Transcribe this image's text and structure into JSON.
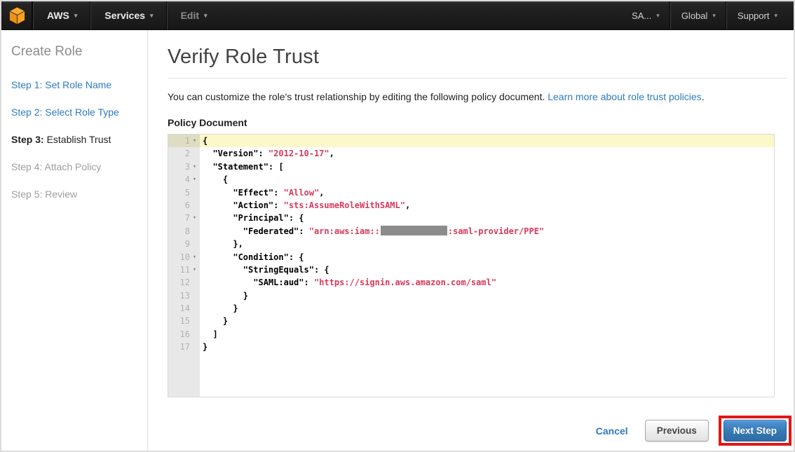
{
  "topbar": {
    "logo": "aws-cube",
    "left_items": [
      {
        "label": "AWS",
        "caret": "▾",
        "style": "bright"
      },
      {
        "label": "Services",
        "caret": "▾",
        "style": "bright"
      },
      {
        "label": "Edit",
        "caret": "▾",
        "style": "dim"
      }
    ],
    "right_items": [
      {
        "label": "SA...",
        "caret": "▾"
      },
      {
        "label": "Global",
        "caret": "▾"
      },
      {
        "label": "Support",
        "caret": "▾"
      }
    ]
  },
  "sidebar": {
    "title": "Create Role",
    "steps": [
      {
        "label": "Step 1: Set Role Name",
        "state": "link"
      },
      {
        "label": "Step 2: Select Role Type",
        "state": "link"
      },
      {
        "label": "Step 3: Establish Trust",
        "state": "current"
      },
      {
        "label": "Step 4: Attach Policy",
        "state": "disabled"
      },
      {
        "label": "Step 5: Review",
        "state": "disabled"
      }
    ]
  },
  "main": {
    "title": "Verify Role Trust",
    "description": "You can customize the role's trust relationship by editing the following policy document.",
    "learn_more_link": "Learn more about role trust policies",
    "learn_more_suffix": ".",
    "policy_label": "Policy Document"
  },
  "editor": {
    "colors": {
      "string": "#d63a5c",
      "plain": "#000000",
      "active_line": "#fcf8c9",
      "gutter_bg": "#e8e8e8",
      "redaction": "#8c8c8c"
    },
    "lines": [
      {
        "n": 1,
        "fold": true,
        "active": true,
        "tokens": [
          [
            "p",
            "{"
          ]
        ]
      },
      {
        "n": 2,
        "fold": false,
        "active": false,
        "tokens": [
          [
            "p",
            "  \"Version\": "
          ],
          [
            "s",
            "\"2012-10-17\""
          ],
          [
            "p",
            ","
          ]
        ]
      },
      {
        "n": 3,
        "fold": true,
        "active": false,
        "tokens": [
          [
            "p",
            "  \"Statement\": ["
          ]
        ]
      },
      {
        "n": 4,
        "fold": true,
        "active": false,
        "tokens": [
          [
            "p",
            "    {"
          ]
        ]
      },
      {
        "n": 5,
        "fold": false,
        "active": false,
        "tokens": [
          [
            "p",
            "      \"Effect\": "
          ],
          [
            "s",
            "\"Allow\""
          ],
          [
            "p",
            ","
          ]
        ]
      },
      {
        "n": 6,
        "fold": false,
        "active": false,
        "tokens": [
          [
            "p",
            "      \"Action\": "
          ],
          [
            "s",
            "\"sts:AssumeRoleWithSAML\""
          ],
          [
            "p",
            ","
          ]
        ]
      },
      {
        "n": 7,
        "fold": true,
        "active": false,
        "tokens": [
          [
            "p",
            "      \"Principal\": {"
          ]
        ]
      },
      {
        "n": 8,
        "fold": false,
        "active": false,
        "tokens": [
          [
            "p",
            "        \"Federated\": "
          ],
          [
            "s",
            "\"arn:aws:iam::"
          ],
          [
            "r",
            ""
          ],
          [
            "s",
            ":saml-provider/PPE\""
          ]
        ]
      },
      {
        "n": 9,
        "fold": false,
        "active": false,
        "tokens": [
          [
            "p",
            "      },"
          ]
        ]
      },
      {
        "n": 10,
        "fold": true,
        "active": false,
        "tokens": [
          [
            "p",
            "      \"Condition\": {"
          ]
        ]
      },
      {
        "n": 11,
        "fold": true,
        "active": false,
        "tokens": [
          [
            "p",
            "        \"StringEquals\": {"
          ]
        ]
      },
      {
        "n": 12,
        "fold": false,
        "active": false,
        "tokens": [
          [
            "p",
            "          \"SAML:aud\": "
          ],
          [
            "s",
            "\"https://signin.aws.amazon.com/saml\""
          ]
        ]
      },
      {
        "n": 13,
        "fold": false,
        "active": false,
        "tokens": [
          [
            "p",
            "        }"
          ]
        ]
      },
      {
        "n": 14,
        "fold": false,
        "active": false,
        "tokens": [
          [
            "p",
            "      }"
          ]
        ]
      },
      {
        "n": 15,
        "fold": false,
        "active": false,
        "tokens": [
          [
            "p",
            "    }"
          ]
        ]
      },
      {
        "n": 16,
        "fold": false,
        "active": false,
        "tokens": [
          [
            "p",
            "  ]"
          ]
        ]
      },
      {
        "n": 17,
        "fold": false,
        "active": false,
        "tokens": [
          [
            "p",
            "}"
          ]
        ]
      }
    ]
  },
  "footer": {
    "cancel_label": "Cancel",
    "previous_label": "Previous",
    "next_label": "Next Step",
    "highlight_color": "#e01717"
  }
}
